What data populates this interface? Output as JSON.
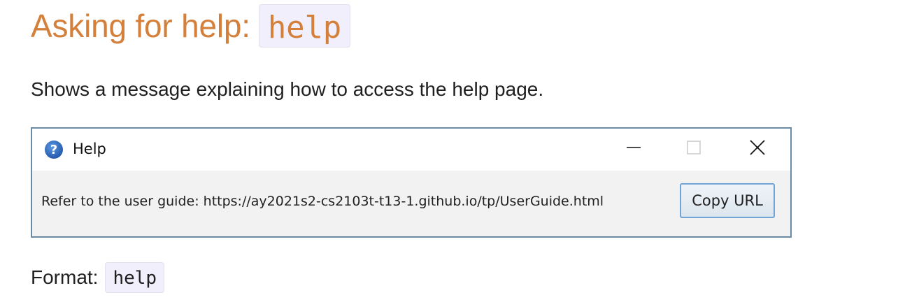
{
  "section": {
    "heading_prefix": "Asking for help:",
    "heading_code": "help",
    "description": "Shows a message explaining how to access the help page.",
    "format_label": "Format:",
    "format_code": "help"
  },
  "dialog": {
    "title": "Help",
    "icon": "question-mark-icon",
    "message": "Refer to the user guide: https://ay2021s2-cs2103t-t13-1.github.io/tp/UserGuide.html",
    "copy_button_label": "Copy URL",
    "controls": [
      "minimize-icon",
      "maximize-icon",
      "close-icon"
    ]
  },
  "colors": {
    "heading": "#d47f3a",
    "code_chip_bg": "#f1effb",
    "dialog_border": "#6b8aa3",
    "icon_blue": "#2f6fc6",
    "button_border": "#72a5d6"
  }
}
